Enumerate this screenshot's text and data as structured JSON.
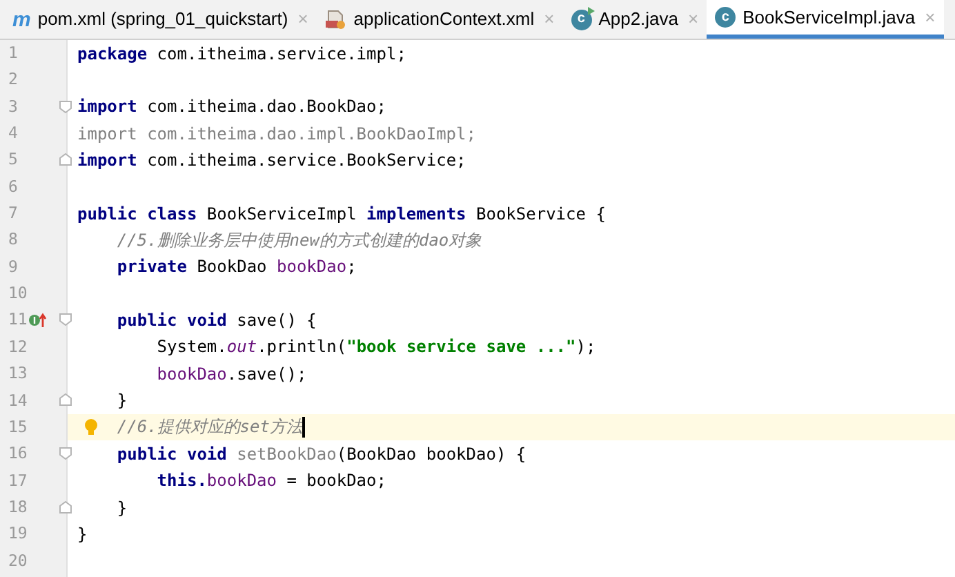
{
  "tabs": [
    {
      "label": "pom.xml (spring_01_quickstart)",
      "kind": "maven",
      "glyph": "m",
      "close": "×",
      "selected": false
    },
    {
      "label": "applicationContext.xml",
      "kind": "xml",
      "close": "×",
      "selected": false
    },
    {
      "label": "App2.java",
      "kind": "runnable-class",
      "glyph": "c",
      "close": "×",
      "selected": false
    },
    {
      "label": "BookServiceImpl.java",
      "kind": "class",
      "glyph": "c",
      "close": "×",
      "selected": true
    }
  ],
  "editor": {
    "lines": [
      {
        "number": "1",
        "current": false,
        "tokens": [
          {
            "text": "package ",
            "kind": "keyword"
          },
          {
            "text": "com.itheima.service.impl;",
            "kind": "plain"
          }
        ]
      },
      {
        "number": "2",
        "current": false
      },
      {
        "number": "3",
        "current": false,
        "fold_start": true,
        "tokens": [
          {
            "text": "import ",
            "kind": "keyword"
          },
          {
            "text": "com.itheima.dao.BookDao;",
            "kind": "plain"
          }
        ]
      },
      {
        "number": "4",
        "current": false,
        "tokens": [
          {
            "text": "import com.itheima.dao.impl.BookDaoImpl;",
            "kind": "unused"
          }
        ]
      },
      {
        "number": "5",
        "current": false,
        "fold_end": true,
        "tokens": [
          {
            "text": "import ",
            "kind": "keyword"
          },
          {
            "text": "com.itheima.service.BookService;",
            "kind": "plain"
          }
        ]
      },
      {
        "number": "6",
        "current": false
      },
      {
        "number": "7",
        "current": false,
        "tokens": [
          {
            "text": "public class ",
            "kind": "keyword"
          },
          {
            "text": "BookServiceImpl ",
            "kind": "plain"
          },
          {
            "text": "implements ",
            "kind": "keyword"
          },
          {
            "text": "BookService {",
            "kind": "plain"
          }
        ]
      },
      {
        "number": "8",
        "current": false,
        "tokens": [
          {
            "text": "    //5.删除业务层中使用new的方式创建的dao对象",
            "kind": "comment"
          }
        ]
      },
      {
        "number": "9",
        "current": false,
        "tokens": [
          {
            "text": "    private ",
            "kind": "keyword"
          },
          {
            "text": "BookDao ",
            "kind": "plain"
          },
          {
            "text": "bookDao",
            "kind": "field"
          },
          {
            "text": ";",
            "kind": "plain"
          }
        ]
      },
      {
        "number": "10",
        "current": false
      },
      {
        "number": "11",
        "current": false,
        "fold_start": true,
        "implements_marker": true,
        "tokens": [
          {
            "text": "    public void ",
            "kind": "keyword"
          },
          {
            "text": "save() {",
            "kind": "plain"
          }
        ]
      },
      {
        "number": "12",
        "current": false,
        "tokens": [
          {
            "text": "        System.",
            "kind": "plain"
          },
          {
            "text": "out",
            "kind": "static"
          },
          {
            "text": ".println(",
            "kind": "plain"
          },
          {
            "text": "\"book service save ...\"",
            "kind": "string"
          },
          {
            "text": ");",
            "kind": "plain"
          }
        ]
      },
      {
        "number": "13",
        "current": false,
        "tokens": [
          {
            "text": "        bookDao",
            "kind": "field"
          },
          {
            "text": ".save();",
            "kind": "plain"
          }
        ]
      },
      {
        "number": "14",
        "current": false,
        "fold_end": true,
        "tokens": [
          {
            "text": "    }",
            "kind": "plain"
          }
        ]
      },
      {
        "number": "15",
        "current": true,
        "bulb": true,
        "tokens": [
          {
            "text": "    //6.提供对应的set方法",
            "kind": "comment"
          }
        ]
      },
      {
        "number": "16",
        "current": false,
        "fold_start": true,
        "tokens": [
          {
            "text": "    public void ",
            "kind": "keyword"
          },
          {
            "text": "setBookDao",
            "kind": "unused"
          },
          {
            "text": "(BookDao bookDao) {",
            "kind": "plain"
          }
        ]
      },
      {
        "number": "17",
        "current": false,
        "tokens": [
          {
            "text": "        this.",
            "kind": "keyword"
          },
          {
            "text": "bookDao",
            "kind": "field"
          },
          {
            "text": " = bookDao;",
            "kind": "plain"
          }
        ]
      },
      {
        "number": "18",
        "current": false,
        "fold_end": true,
        "tokens": [
          {
            "text": "    }",
            "kind": "plain"
          }
        ]
      },
      {
        "number": "19",
        "current": false,
        "tokens": [
          {
            "text": "}",
            "kind": "plain"
          }
        ]
      },
      {
        "number": "20",
        "current": false
      }
    ]
  }
}
